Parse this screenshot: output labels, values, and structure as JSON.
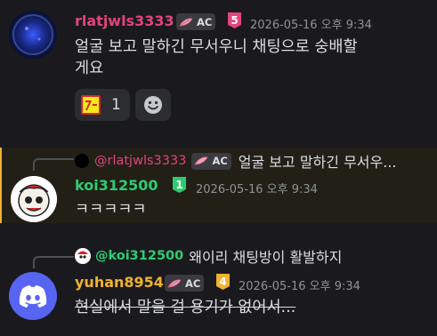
{
  "messages": [
    {
      "username": "rlatjwls3333",
      "name_color": "#e0457b",
      "tag": "AC",
      "level": "5",
      "timestamp": "2026-05-16 오후 9:34",
      "content_line1": "얼굴 보고 말하긴 무서우니 채팅으로 숭배할",
      "content_line2": "게요",
      "reactions": [
        {
          "emoji": "custom-emoji",
          "count": "1"
        },
        {
          "emoji": "smile-emoji-add"
        }
      ]
    },
    {
      "reply": {
        "mention": "@rlatjwls3333",
        "tag": "AC",
        "preview": "얼굴 보고 말하긴 무서우..."
      },
      "username": "koi312500",
      "name_color": "#2ecc71",
      "level": "1",
      "timestamp": "2026-05-16 오후 9:34",
      "content": "ㅋㅋㅋㅋㅋ"
    },
    {
      "reply": {
        "mention": "@koi312500",
        "preview": "왜이리 채팅방이 활발하지"
      },
      "username": "yuhan8954",
      "name_color": "#f0b232",
      "tag": "AC",
      "level": "4",
      "timestamp": "2026-05-16 오후 9:34",
      "content": "현실에서 말을 걸 용기가 없어서..."
    }
  ],
  "colors": {
    "background": "#1a1a1e",
    "highlight_background": "#221f17",
    "highlight_bar": "#f0b232",
    "mention_color": "#c9cdfb",
    "level_5": "#e0457b",
    "level_1": "#2ecc71",
    "level_4": "#f0b232",
    "discord_blue": "#5865f2"
  }
}
